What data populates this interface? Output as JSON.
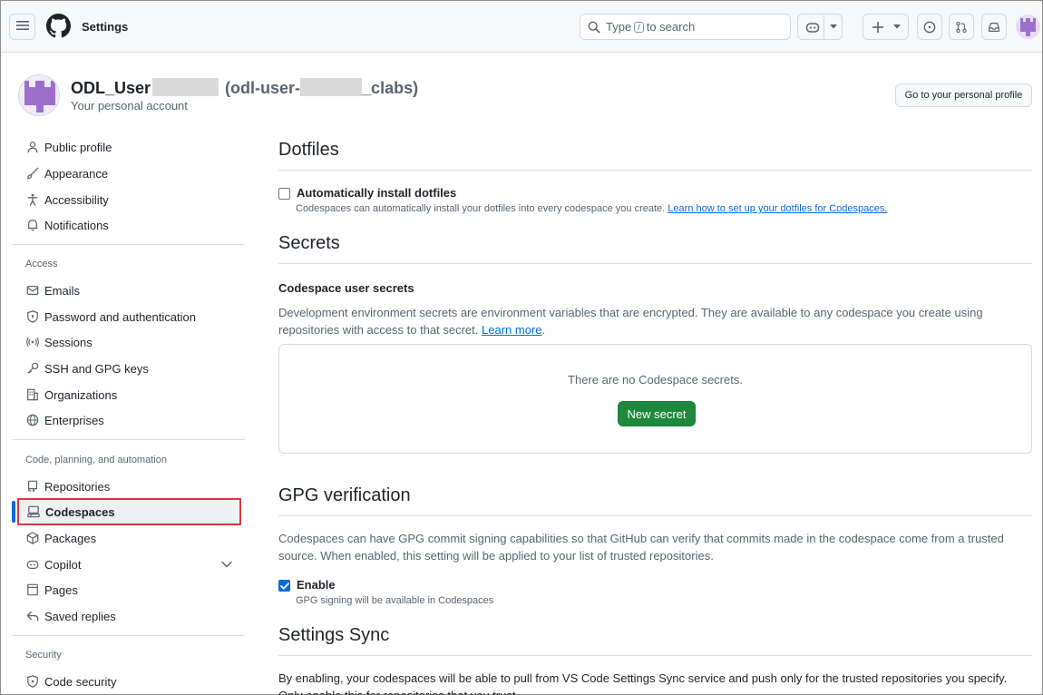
{
  "header": {
    "title": "Settings",
    "search_placeholder_pre": "Type",
    "search_key": "/",
    "search_placeholder_post": "to search"
  },
  "profile": {
    "name": "ODL_User",
    "handle_pre": "(odl-user-",
    "handle_post": "_clabs)",
    "subtitle": "Your personal account",
    "go_to_profile_label": "Go to your personal profile"
  },
  "sidebar": {
    "group1": [
      {
        "label": "Public profile",
        "icon": "person-icon"
      },
      {
        "label": "Appearance",
        "icon": "paintbrush-icon"
      },
      {
        "label": "Accessibility",
        "icon": "accessibility-icon"
      },
      {
        "label": "Notifications",
        "icon": "bell-icon"
      }
    ],
    "access_heading": "Access",
    "access": [
      {
        "label": "Emails",
        "icon": "mail-icon"
      },
      {
        "label": "Password and authentication",
        "icon": "shield-lock-icon"
      },
      {
        "label": "Sessions",
        "icon": "broadcast-icon"
      },
      {
        "label": "SSH and GPG keys",
        "icon": "key-icon"
      },
      {
        "label": "Organizations",
        "icon": "organization-icon"
      },
      {
        "label": "Enterprises",
        "icon": "globe-icon"
      }
    ],
    "code_heading": "Code, planning, and automation",
    "code": [
      {
        "label": "Repositories",
        "icon": "repo-icon"
      },
      {
        "label": "Codespaces",
        "icon": "codespaces-icon",
        "active": true
      },
      {
        "label": "Packages",
        "icon": "package-icon"
      },
      {
        "label": "Copilot",
        "icon": "copilot-icon"
      },
      {
        "label": "Pages",
        "icon": "browser-icon"
      },
      {
        "label": "Saved replies",
        "icon": "reply-icon"
      }
    ],
    "security_heading": "Security",
    "security": [
      {
        "label": "Code security",
        "icon": "shield-icon"
      }
    ]
  },
  "main": {
    "dotfiles": {
      "heading": "Dotfiles",
      "checkbox_label": "Automatically install dotfiles",
      "checked": false,
      "note": "Codespaces can automatically install your dotfiles into every codespace you create.",
      "link": "Learn how to set up your dotfiles for Codespaces."
    },
    "secrets": {
      "heading": "Secrets",
      "subheading": "Codespace user secrets",
      "description": "Development environment secrets are environment variables that are encrypted. They are available to any codespace you create using repositories with access to that secret.",
      "learn_more": "Learn more",
      "period": ".",
      "empty": "There are no Codespace secrets.",
      "new_secret": "New secret"
    },
    "gpg": {
      "heading": "GPG verification",
      "description": "Codespaces can have GPG commit signing capabilities so that GitHub can verify that commits made in the codespace come from a trusted source. When enabled, this setting will be applied to your list of trusted repositories.",
      "checkbox_label": "Enable",
      "checked": true,
      "note": "GPG signing will be available in Codespaces"
    },
    "sync": {
      "heading": "Settings Sync",
      "description": "By enabling, your codespaces will be able to pull from VS Code Settings Sync service and push only for the trusted repositories you specify. Only enable this for repositories that you trust."
    }
  },
  "colors": {
    "accent": "#0969da",
    "primary_button": "#1f883d",
    "highlight_border": "#d73a3a"
  }
}
